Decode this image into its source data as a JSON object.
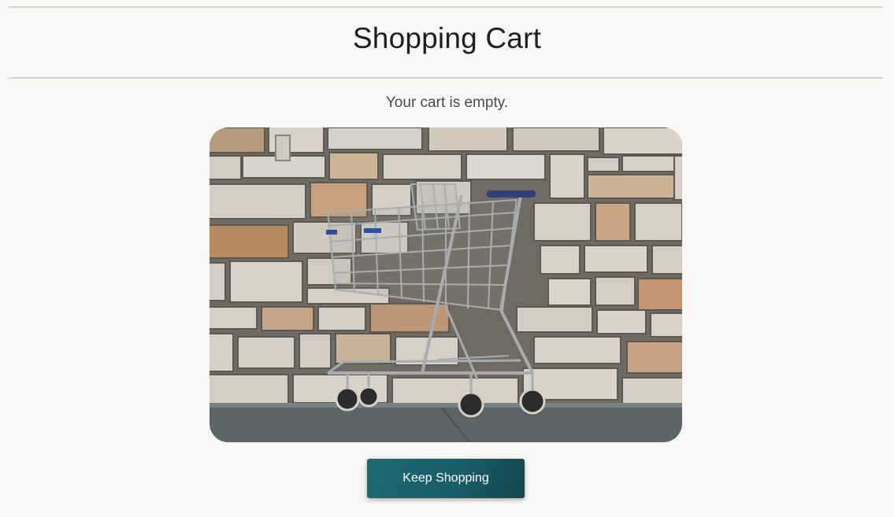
{
  "page": {
    "title": "Shopping Cart",
    "empty_message": "Your cart is empty."
  },
  "hero_image": {
    "subject": "empty shopping cart in front of a stone wall"
  },
  "actions": {
    "keep_shopping_label": "Keep Shopping"
  },
  "colors": {
    "background": "#f8f7f5",
    "button_accent": "#1d6a73",
    "divider": "#d6d4d1"
  }
}
